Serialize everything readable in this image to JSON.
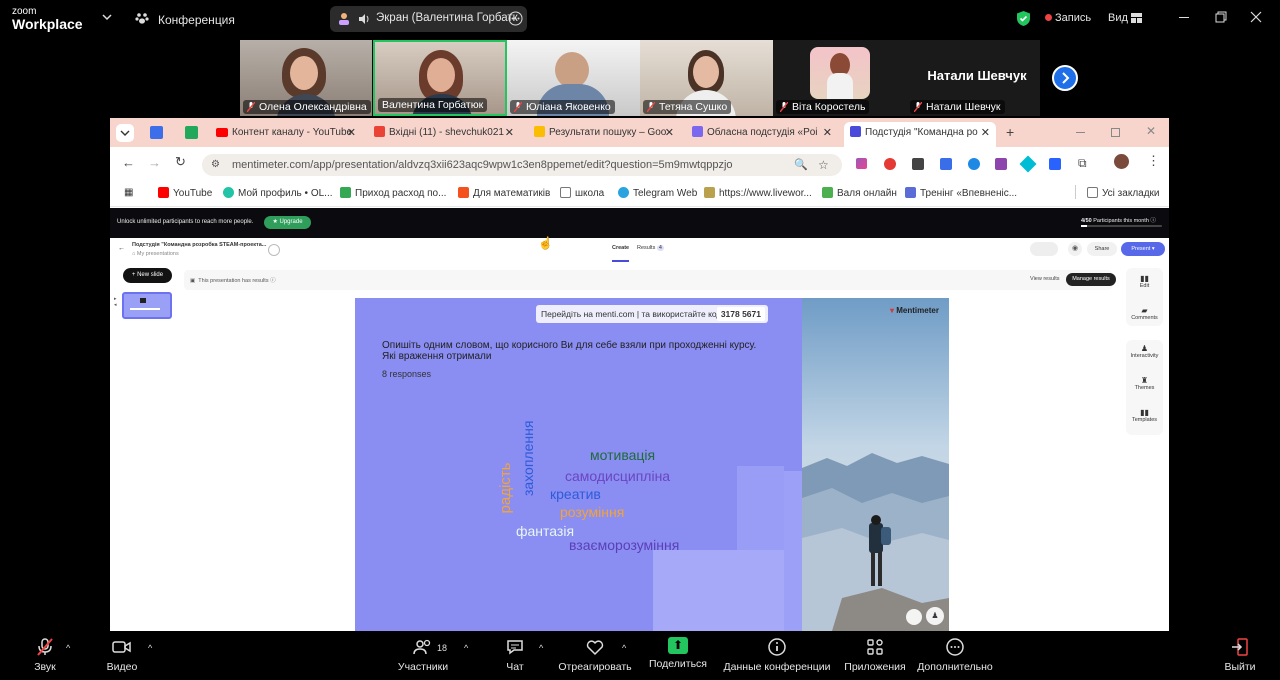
{
  "zoom": {
    "logo_top": "zoom",
    "logo_bottom": "Workplace",
    "meeting_title": "Конференция",
    "share_label": "Экран (Валентина Горбатк",
    "record_label": "Запись",
    "view_label": "Вид"
  },
  "participants": [
    {
      "name": "Олена Олександрівна",
      "muted": true
    },
    {
      "name": "Валентина Горбатюк",
      "muted": false
    },
    {
      "name": "Юліана Яковенко",
      "muted": true
    },
    {
      "name": "Тетяна Сушко",
      "muted": true
    },
    {
      "name": "Віта Коростель",
      "muted": true
    },
    {
      "name": "Натали Шевчук",
      "muted": true
    }
  ],
  "big_name": "Натали Шевчук",
  "browser": {
    "tabs": [
      {
        "label": "Контент каналу - YouTube",
        "icon_color": "#ff0000"
      },
      {
        "label": "Вхідні (11) - shevchuk021",
        "icon_color": "#ea4335"
      },
      {
        "label": "Результати пошуку – Goo",
        "icon_color": "#fbbc04"
      },
      {
        "label": "Обласна подстудія «Poi",
        "icon_color": "#7b68ee"
      },
      {
        "label": "Подстудія \"Командна ро",
        "icon_color": "#4a4adb"
      }
    ],
    "url": "mentimeter.com/app/presentation/aldvzq3xii623aqc9wpw1c3en8ppemet/edit?question=5m9mwtqppzjo",
    "bookmarks": [
      {
        "label": "YouTube",
        "color": "#ff0000"
      },
      {
        "label": "Мой профиль • OL...",
        "color": "#22c3a6"
      },
      {
        "label": "Приход расход по...",
        "color": "#34a853"
      },
      {
        "label": "Для математиків",
        "color": "#f4511e"
      },
      {
        "label": "школа",
        "color": "#888888"
      },
      {
        "label": "Telegram Web",
        "color": "#2aa3e0"
      },
      {
        "label": "https://www.livewor...",
        "color": "#b9a14d"
      },
      {
        "label": "Валя онлайн",
        "color": "#4caf50"
      },
      {
        "label": "Тренінг «Впевненіс...",
        "color": "#5b6cd6"
      }
    ],
    "all_bookmarks": "Усі закладки"
  },
  "menti": {
    "unlock_text": "Unlock unlimited participants to reach more people.",
    "upgrade_label": "Upgrade",
    "participants_count": "4/50",
    "participants_text": "Participants this month",
    "presentation_title": "Подстудія \"Командна розробка STEAM-проекта...",
    "my_presentations": "My presentations",
    "tab_create": "Create",
    "tab_results": "Results",
    "results_count": "4",
    "share_label": "Share",
    "present_label": "Present",
    "new_slide": "+ New slide",
    "no_results_text": "This presentation has results",
    "view_results": "View results",
    "manage_results": "Manage results",
    "side_tools": [
      "Edit",
      "Comments",
      "Interactivity",
      "Themes",
      "Templates"
    ]
  },
  "slide": {
    "join_text": "Перейдіть на menti.com | та використайте код",
    "join_code": "3178 5671",
    "brand": "Mentimeter",
    "question": "Опишіть одним словом, що корисного Ви для себе взяли при проходженні курсу. Які враження отримали",
    "responses": "8 responses",
    "words": [
      {
        "text": "мотивація",
        "color": "#1f6b3a",
        "size": 14
      },
      {
        "text": "самодисципліна",
        "color": "#6b46c1",
        "size": 14
      },
      {
        "text": "креатив",
        "color": "#2e5bd8",
        "size": 14
      },
      {
        "text": "розуміння",
        "color": "#f2a33a",
        "size": 14
      },
      {
        "text": "фантазія",
        "color": "#e8f7f2",
        "size": 14
      },
      {
        "text": "взаєморозуміння",
        "color": "#5c3fb8",
        "size": 14
      },
      {
        "text": "радість",
        "color": "#f2a33a",
        "size": 15
      },
      {
        "text": "захоплення",
        "color": "#2e5bd8",
        "size": 14
      }
    ]
  },
  "toolbar": {
    "sound": "Звук",
    "video": "Видео",
    "participants": "Участники",
    "participants_count": "18",
    "chat": "Чат",
    "react": "Отреагировать",
    "share": "Поделиться",
    "meeting_info": "Данные конференции",
    "apps": "Приложения",
    "more": "Дополнительно",
    "leave": "Выйти"
  },
  "colors": {
    "slide_bg": "#8a8df2",
    "accent_green": "#22c55e",
    "record_red": "#ef4444",
    "tab_bar": "#f7d5cc"
  }
}
